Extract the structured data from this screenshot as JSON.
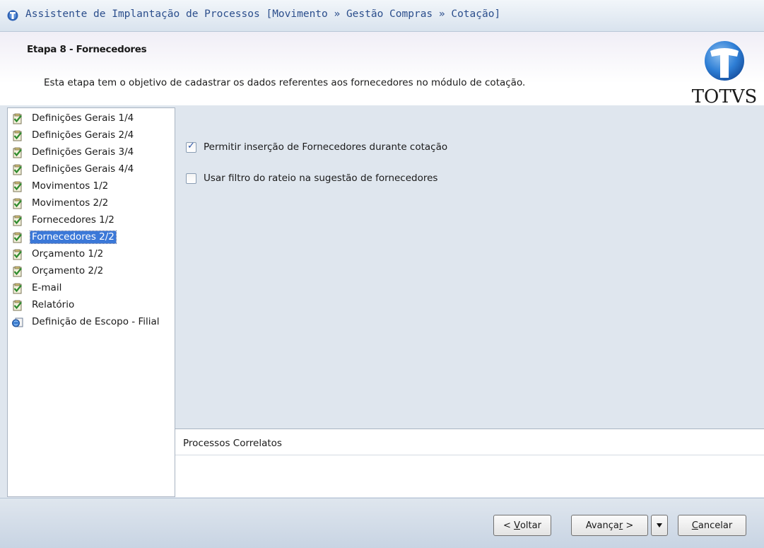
{
  "window": {
    "title": "Assistente de Implantação de Processos [Movimento » Gestão Compras » Cotação]"
  },
  "header": {
    "step_title": "Etapa 8 - Fornecedores",
    "step_description": "Esta etapa tem o objetivo de cadastrar os dados referentes aos fornecedores no módulo de cotação.",
    "logo_text": "TOTVS",
    "colors": {
      "logo_blue": "#1f6cc4",
      "logo_text": "#1a1a1a"
    }
  },
  "nav": {
    "items": [
      {
        "label": "Definições Gerais 1/4",
        "icon": "checked-doc-icon",
        "selected": false
      },
      {
        "label": "Definições Gerais 2/4",
        "icon": "checked-doc-icon",
        "selected": false
      },
      {
        "label": "Definições Gerais 3/4",
        "icon": "checked-doc-icon",
        "selected": false
      },
      {
        "label": "Definições Gerais 4/4",
        "icon": "checked-doc-icon",
        "selected": false
      },
      {
        "label": "Movimentos 1/2",
        "icon": "checked-doc-icon",
        "selected": false
      },
      {
        "label": "Movimentos 2/2",
        "icon": "checked-doc-icon",
        "selected": false
      },
      {
        "label": "Fornecedores 1/2",
        "icon": "checked-doc-icon",
        "selected": false
      },
      {
        "label": "Fornecedores 2/2",
        "icon": "checked-doc-icon",
        "selected": true
      },
      {
        "label": "Orçamento 1/2",
        "icon": "checked-doc-icon",
        "selected": false
      },
      {
        "label": "Orçamento 2/2",
        "icon": "checked-doc-icon",
        "selected": false
      },
      {
        "label": "E-mail",
        "icon": "checked-doc-icon",
        "selected": false
      },
      {
        "label": "Relatório",
        "icon": "checked-doc-icon",
        "selected": false
      },
      {
        "label": "Definição de Escopo - Filial",
        "icon": "scope-doc-icon",
        "selected": false
      }
    ],
    "colors": {
      "selected_bg": "#3b78d8",
      "selected_text": "#ffffff"
    }
  },
  "options": [
    {
      "label": "Permitir inserção de Fornecedores durante cotação",
      "checked": true
    },
    {
      "label": "Usar filtro do rateio na sugestão de fornecedores",
      "checked": false
    }
  ],
  "related": {
    "header": "Processos Correlatos"
  },
  "footer": {
    "back_prefix": "< ",
    "back_key": "V",
    "back_rest": "oltar",
    "next_prefix": "Avança",
    "next_key": "r",
    "next_suffix": " >",
    "dropdown_icon": "dropdown-arrow-icon",
    "cancel_key": "C",
    "cancel_rest": "ancelar"
  }
}
